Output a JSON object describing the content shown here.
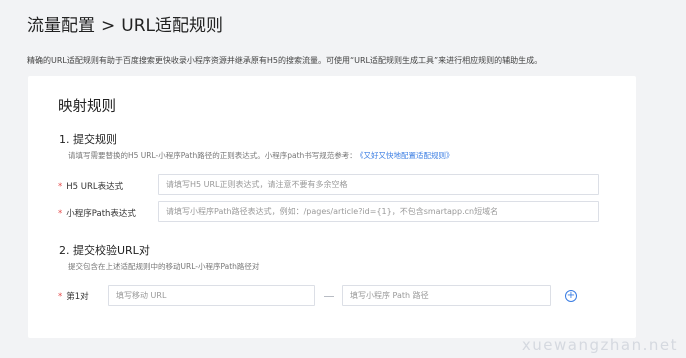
{
  "header": {
    "breadcrumb_parent": "流量配置",
    "separator": ">",
    "breadcrumb_current": "URL适配规则"
  },
  "description": "精确的URL适配规则有助于百度搜索更快收录小程序资源并继承原有H5的搜索流量。可使用“URL适配规则生成工具”来进行相应规则的辅助生成。",
  "card": {
    "title": "映射规则",
    "section1": {
      "title": "1. 提交规则",
      "subtitle": "请填写需要替换的H5 URL-小程序Path路径的正则表达式。小程序path书写规范参考：",
      "link": "《又好又快地配置适配规则》",
      "h5_label": "H5 URL表达式",
      "h5_placeholder": "请填写H5 URL正则表达式，请注意不要有多余空格",
      "path_label": "小程序Path表达式",
      "path_placeholder": "请填写小程序Path路径表达式，例如：/pages/article?id={1}，不包含smartapp.cn短域名"
    },
    "section2": {
      "title": "2. 提交校验URL对",
      "subtitle": "提交包含在上述适配规则中的移动URL-小程序Path路径对",
      "pair_label": "第1对",
      "mobile_placeholder": "填写移动 URL",
      "path_placeholder": "填写小程序 Path 路径",
      "dash": "—",
      "add_icon": "+"
    },
    "required_mark": "*"
  },
  "watermark": "xuewangzhan.net",
  "colors": {
    "link": "#3a7de3",
    "required": "#e64a4a",
    "background": "#f2f3f5"
  }
}
